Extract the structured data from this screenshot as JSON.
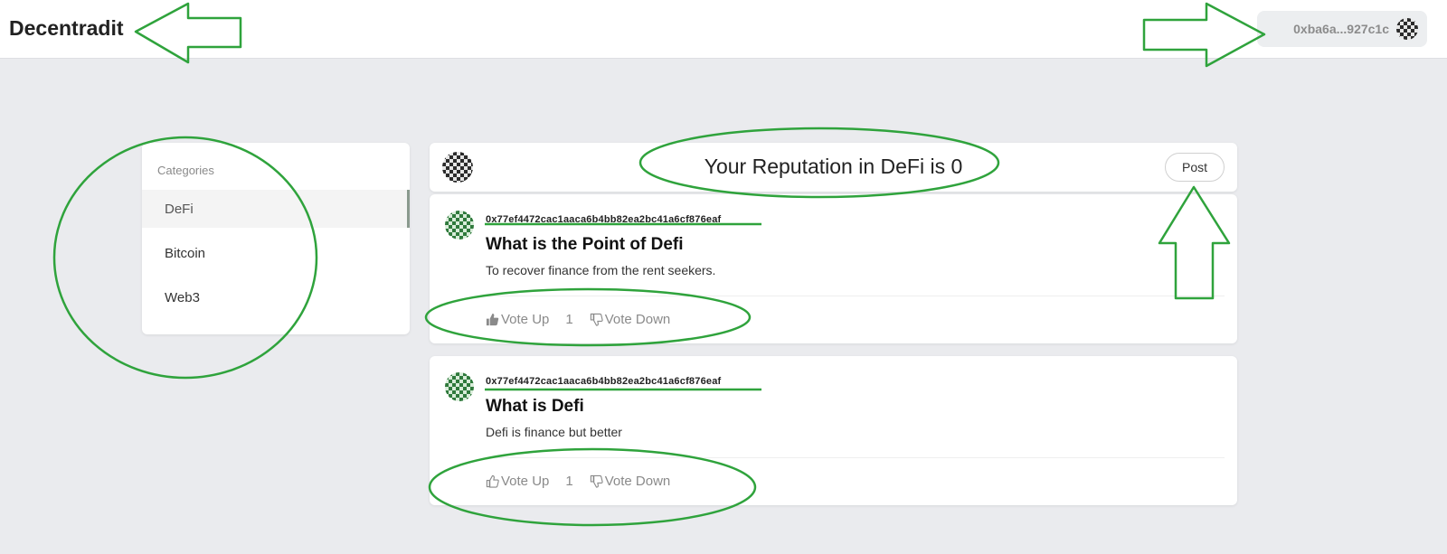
{
  "header": {
    "brand": "Decentradit",
    "wallet_label": "0xba6a...927c1c",
    "wallet_avatar_icon": "identicon-avatar"
  },
  "sidebar": {
    "title": "Categories",
    "items": [
      {
        "label": "DeFi",
        "active": true
      },
      {
        "label": "Bitcoin",
        "active": false
      },
      {
        "label": "Web3",
        "active": false
      }
    ]
  },
  "reputation": {
    "title": "Your Reputation in DeFi is 0",
    "post_button": "Post"
  },
  "posts": [
    {
      "author": "0x77ef4472cac1aaca6b4bb82ea2bc41a6cf876eaf",
      "title": "What is the Point of Defi",
      "body": "To recover finance from the rent seekers.",
      "vote_up": "Vote Up",
      "votes": "1",
      "vote_down": "Vote Down"
    },
    {
      "author": "0x77ef4472cac1aaca6b4bb82ea2bc41a6cf876eaf",
      "title": "What is Defi",
      "body": "Defi is finance but better",
      "vote_up": "Vote Up",
      "votes": "1",
      "vote_down": "Vote Down"
    }
  ],
  "colors": {
    "annotation": "#2fa33c",
    "background": "#eaebee",
    "muted_text": "#8a8a8a"
  }
}
